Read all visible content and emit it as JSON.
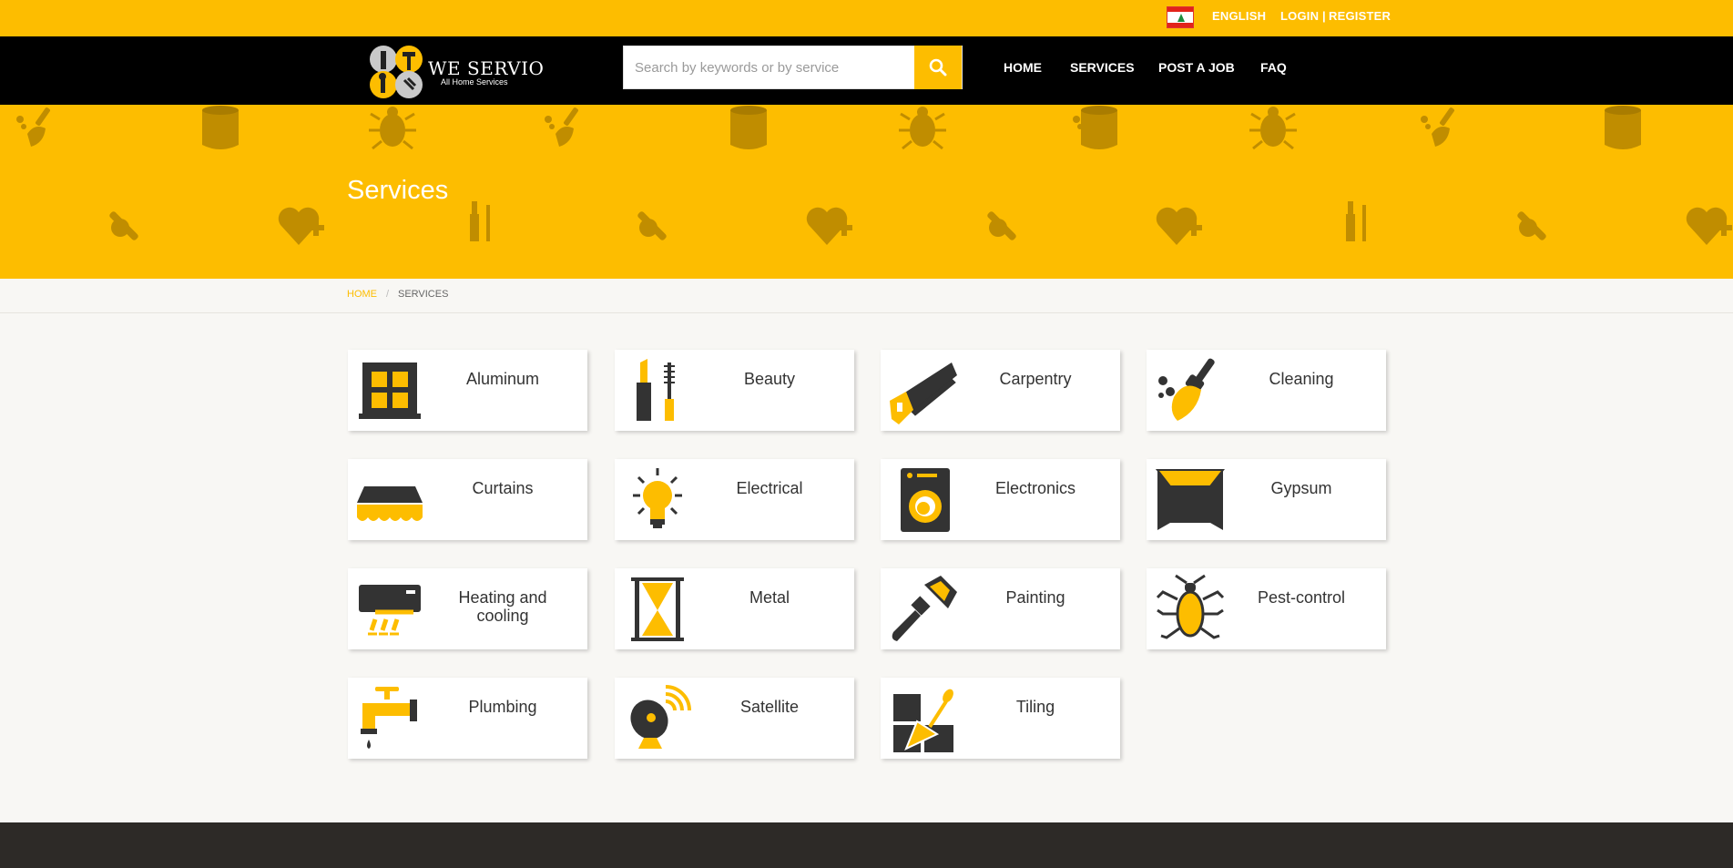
{
  "topbar": {
    "language": "ENGLISH",
    "login": "LOGIN |",
    "register": "REGISTER"
  },
  "brand": {
    "name": "WE SERVIO",
    "tagline": "All Home Services"
  },
  "search": {
    "placeholder": "Search by keywords or by service"
  },
  "nav": {
    "home": "HOME",
    "services": "SERVICES",
    "post_job": "POST A JOB",
    "faq": "FAQ"
  },
  "hero": {
    "title": "Services"
  },
  "breadcrumb": {
    "home": "HOME",
    "sep": "/",
    "current": "SERVICES"
  },
  "services": [
    {
      "label": "Aluminum",
      "icon": "window-icon"
    },
    {
      "label": "Beauty",
      "icon": "lipstick-mascara-icon"
    },
    {
      "label": "Carpentry",
      "icon": "saw-icon"
    },
    {
      "label": "Cleaning",
      "icon": "broom-icon"
    },
    {
      "label": "Curtains",
      "icon": "awning-icon"
    },
    {
      "label": "Electrical",
      "icon": "lightbulb-icon"
    },
    {
      "label": "Electronics",
      "icon": "washing-machine-icon"
    },
    {
      "label": "Gypsum",
      "icon": "ceiling-icon"
    },
    {
      "label": "Heating and cooling",
      "icon": "air-conditioner-icon"
    },
    {
      "label": "Metal",
      "icon": "metal-frame-icon"
    },
    {
      "label": "Painting",
      "icon": "paintbrush-icon"
    },
    {
      "label": "Pest-control",
      "icon": "cockroach-icon"
    },
    {
      "label": "Plumbing",
      "icon": "faucet-icon"
    },
    {
      "label": "Satellite",
      "icon": "satellite-dish-icon"
    },
    {
      "label": "Tiling",
      "icon": "trowel-tiles-icon"
    }
  ],
  "colors": {
    "accent": "#fdbd00",
    "dark": "#2d2a27",
    "nav_bg": "#000000"
  }
}
